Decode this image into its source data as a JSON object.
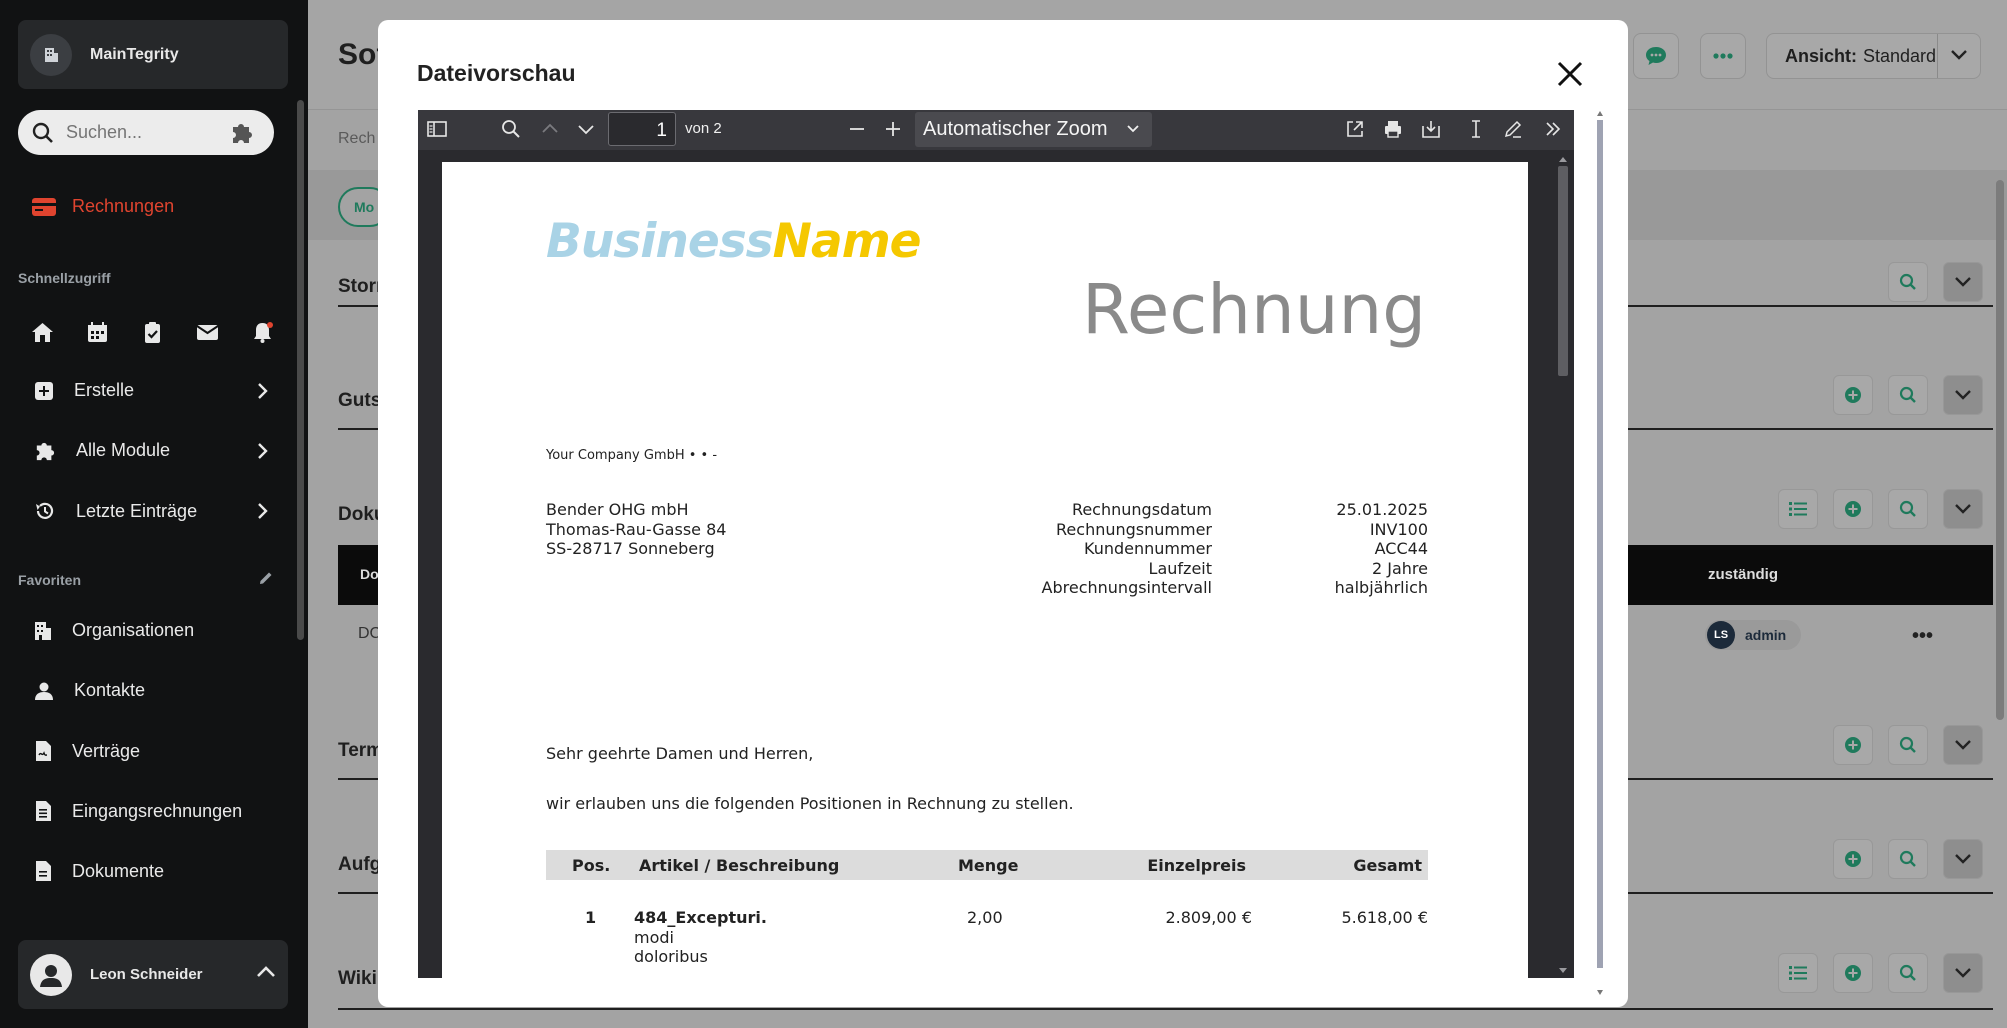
{
  "sidebar": {
    "org_name": "MainTegrity",
    "search_placeholder": "Suchen...",
    "active_item": "Rechnungen",
    "quick_access_label": "Schnellzugriff",
    "menu": [
      {
        "label": "Erstelle"
      },
      {
        "label": "Alle Module"
      },
      {
        "label": "Letzte Einträge"
      }
    ],
    "favorites_label": "Favoriten",
    "favorites": [
      {
        "label": "Organisationen"
      },
      {
        "label": "Kontakte"
      },
      {
        "label": "Verträge"
      },
      {
        "label": "Eingangsrechnungen"
      },
      {
        "label": "Dokumente"
      }
    ],
    "user_name": "Leon Schneider"
  },
  "main": {
    "title_partial": "Sof",
    "breadcrumb_partial": "Rech",
    "mode_chip_partial": "Mo",
    "view_label": "Ansicht:",
    "view_value": "Standard",
    "sections": [
      "Storn",
      "Guts",
      "Doku",
      "Term",
      "Aufg",
      "Wiki"
    ],
    "table_header_partial": "Dok",
    "table_header_assigned": "zuständig",
    "row_cell_partial": "DC",
    "assignee_initials": "LS",
    "assignee_name": "admin",
    "more_label": "•••"
  },
  "modal": {
    "title": "Dateivorschau",
    "viewer": {
      "page_number": "1",
      "page_of": "von 2",
      "zoom": "Automatischer Zoom"
    },
    "invoice": {
      "logo_part1": "Business",
      "logo_part2": "Name",
      "doc_title": "Rechnung",
      "sender_line": "Your Company GmbH •  • -",
      "recipient": [
        "Bender OHG mbH",
        "Thomas-Rau-Gasse 84",
        "SS-28717 Sonneberg"
      ],
      "meta": [
        {
          "key": "Rechnungsdatum",
          "value": "25.01.2025"
        },
        {
          "key": "Rechnungsnummer",
          "value": "INV100"
        },
        {
          "key": "Kundennummer",
          "value": "ACC44"
        },
        {
          "key": "Laufzeit",
          "value": "2 Jahre"
        },
        {
          "key": "Abrechnungsintervall",
          "value": "halbjährlich"
        }
      ],
      "salutation": "Sehr geehrte Damen und Herren,",
      "intro": "wir erlauben uns die folgenden Positionen in Rechnung zu stellen.",
      "columns": {
        "pos": "Pos.",
        "article": "Artikel / Beschreibung",
        "qty": "Menge",
        "unit": "Einzelpreis",
        "total": "Gesamt"
      },
      "items": [
        {
          "pos": "1",
          "article": "484_Excepturi.",
          "desc1": "modi",
          "desc2": "doloribus",
          "qty": "2,00",
          "unit": "2.809,00 €",
          "total": "5.618,00 €"
        }
      ]
    }
  },
  "colors": {
    "accent_red": "#e0442f",
    "accent_green": "#1f7a5c",
    "logo_blue": "#a9d3e6",
    "logo_yellow": "#f5c800"
  }
}
